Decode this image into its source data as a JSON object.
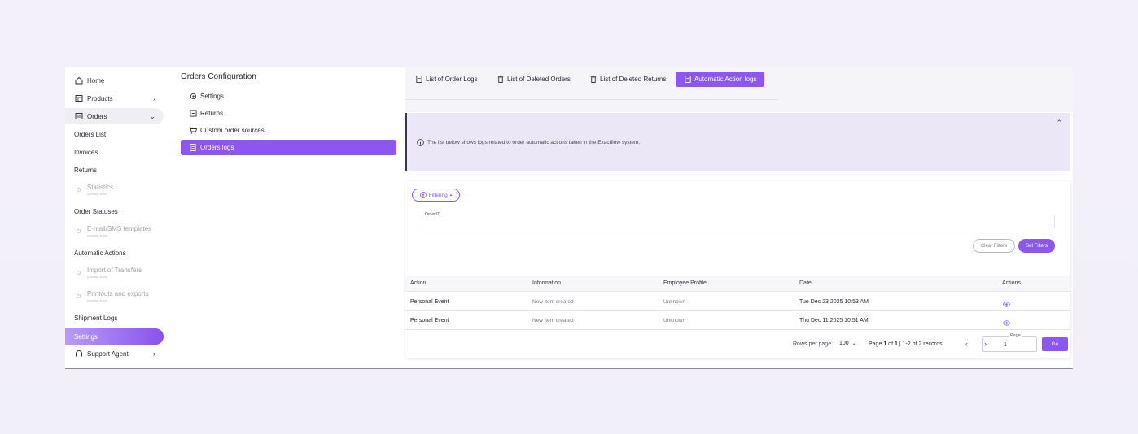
{
  "colors": {
    "accent": "#8b57ef",
    "info_bg": "#ebe7f7"
  },
  "sidebar": {
    "home": "Home",
    "products": "Products",
    "orders": "Orders",
    "orders_list": "Orders List",
    "invoices": "Invoices",
    "returns": "Returns",
    "statistics": "Statistics",
    "statistics_sub": "(coming soon)",
    "order_statuses": "Order Statuses",
    "email_templates": "E-mail/SMS templates",
    "email_templates_sub": "(coming soon)",
    "automatic_actions": "Automatic Actions",
    "import_transfers": "Import of Transfers",
    "import_transfers_sub": "(coming soon)",
    "printouts": "Printouts and exports",
    "printouts_sub": "(coming soon)",
    "shipment_logs": "Shipment Logs",
    "settings": "Settings",
    "support_agent": "Support Agent"
  },
  "config": {
    "title": "Orders Configuration",
    "items": [
      "Settings",
      "Returns",
      "Custom order sources",
      "Orders logs"
    ]
  },
  "tabs": [
    "List of Order Logs",
    "List of Deleted Orders",
    "List of Deleted Returns",
    "Automatic Action logs"
  ],
  "info": {
    "message": "The list below shows logs related to order automatic actions taken in the Exactflow system."
  },
  "filters": {
    "toggle": "Filtering",
    "order_id_label": "Order ID",
    "order_id_value": "",
    "clear": "Clear Filters",
    "set": "Set Filters"
  },
  "table": {
    "headers": [
      "Action",
      "Information",
      "Employee Profile",
      "Date",
      "Actions"
    ],
    "rows": [
      [
        "Personal Event",
        "New item created",
        "Unknown",
        "Tue Dec 23 2025 10:53 AM"
      ],
      [
        "Personal Event",
        "New item created",
        "Unknown",
        "Thu Dec 11 2025 10:51 AM"
      ]
    ]
  },
  "pagination": {
    "rows_per_page_label": "Rows per page",
    "rows_per_page": "100",
    "page_prefix": "Page",
    "page_current": "1",
    "page_of": "of",
    "page_total": "1",
    "records": "1-2 of 2 records",
    "page_label": "Page",
    "page_value": "1",
    "go": "Go"
  }
}
